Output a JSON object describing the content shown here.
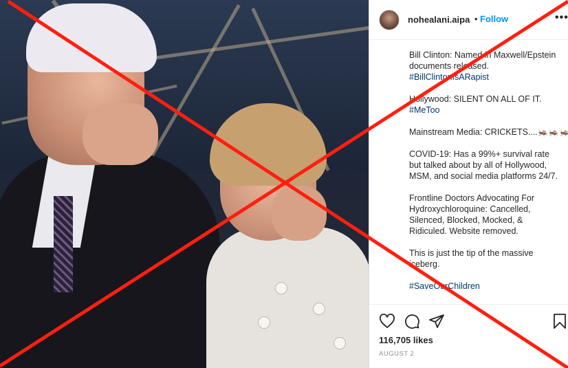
{
  "post": {
    "username": "nohealani.aipa",
    "separator": "•",
    "follow_label": "Follow",
    "more_label": "•••",
    "caption": [
      {
        "lines": [
          "Bill Clinton: Named in Maxwell/Epstein",
          "documents released."
        ],
        "tag": "#BillClintonIsARapist"
      },
      {
        "lines": [
          "Hollywood: SILENT ON ALL OF IT."
        ],
        "tag": "#MeToo"
      },
      {
        "lines": [
          "Mainstream Media: CRICKETS....🦗🦗🦗"
        ],
        "tag": ""
      },
      {
        "lines": [
          "COVID-19: Has a 99%+ survival rate",
          "but talked about by all of Hollywood,",
          "MSM, and social media platforms 24/7."
        ],
        "tag": ""
      },
      {
        "lines": [
          "Frontline Doctors Advocating For",
          "Hydroxychloroquine: Cancelled,",
          "Silenced, Blocked, Mocked, &",
          "Ridiculed. Website removed."
        ],
        "tag": ""
      },
      {
        "lines": [
          "This is just the tip of the massive",
          "iceberg."
        ],
        "tag": ""
      },
      {
        "lines": [],
        "tag": "#SaveOurChildren"
      }
    ],
    "likes": "116,705 likes",
    "date": "AUGUST 2"
  },
  "icons": {
    "like": "heart-icon",
    "comment": "comment-icon",
    "share": "paper-plane-icon",
    "save": "bookmark-icon"
  },
  "overlay": {
    "mark": "red-x",
    "color": "#ff1f0f"
  }
}
